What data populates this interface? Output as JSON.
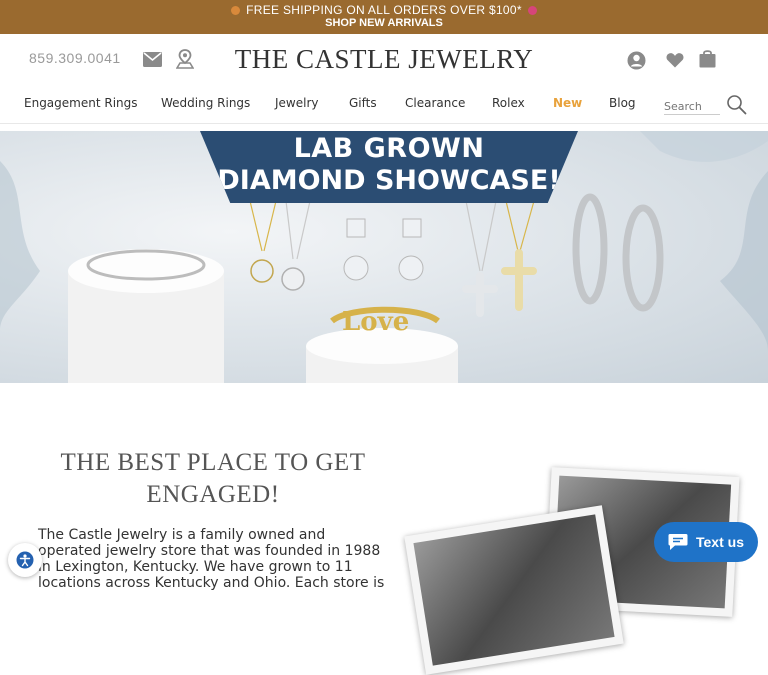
{
  "promo": {
    "line1": "FREE SHIPPING ON ALL ORDERS OVER $100*",
    "line2": "SHOP NEW ARRIVALS"
  },
  "header": {
    "phone": "859.309.0041",
    "logo": "THE CASTLE JEWELRY",
    "icons": [
      "mail-icon",
      "map-pin-icon",
      "account-icon",
      "heart-icon",
      "shopping-bag-icon"
    ]
  },
  "nav": {
    "items": [
      {
        "label": "Engagement Rings"
      },
      {
        "label": "Wedding Rings"
      },
      {
        "label": "Jewelry"
      },
      {
        "label": "Gifts"
      },
      {
        "label": "Clearance"
      },
      {
        "label": "Rolex"
      },
      {
        "label": "New",
        "color": "#e8a23c"
      },
      {
        "label": "Blog"
      }
    ],
    "search_placeholder": "Search"
  },
  "hero": {
    "title_line1": "LAB GROWN",
    "title_line2": "DIAMOND SHOWCASE!",
    "ring_inscription": "Love"
  },
  "section": {
    "heading": "THE BEST PLACE TO GET ENGAGED!",
    "body": "The Castle Jewelry is a family owned and operated jewelry store that was founded in 1988 in Lexington, Kentucky. We have grown to 11 locations across Kentucky and Ohio. Each store is"
  },
  "chat": {
    "label": "Text us"
  },
  "colors": {
    "promo_bg": "#9a6a2f",
    "banner_bg": "#2b4d73",
    "accent_new": "#e8a23c",
    "chat_bg": "#1f73c8"
  }
}
